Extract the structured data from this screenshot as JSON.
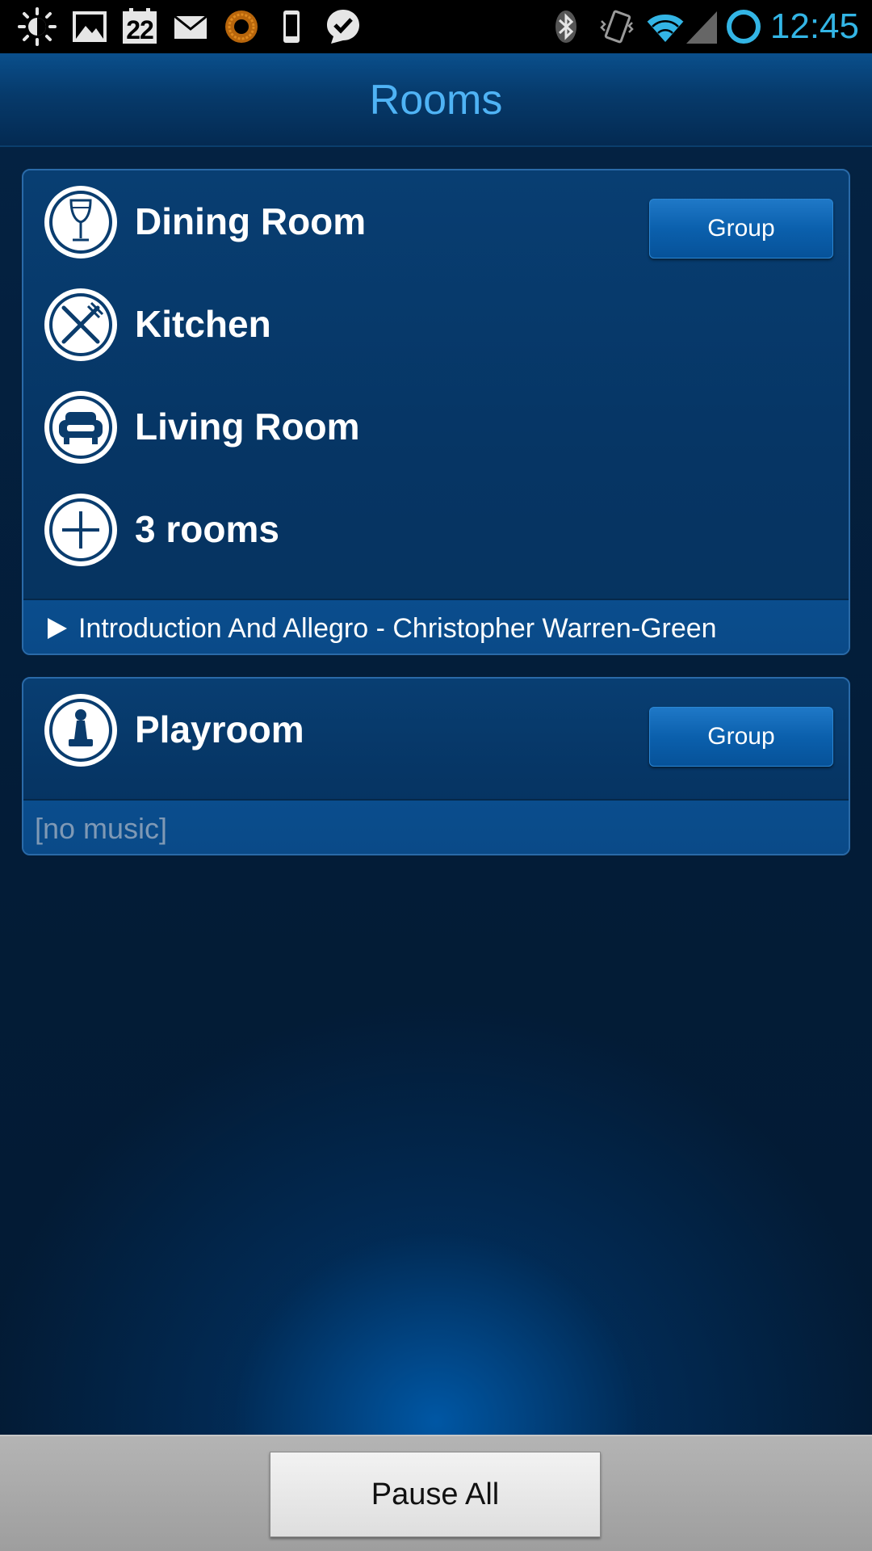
{
  "status_bar": {
    "time": "12:45",
    "calendar_day": "22",
    "accent_color": "#33b5e5",
    "left_icons": [
      "brightness-icon",
      "gallery-icon",
      "calendar-icon",
      "email-icon",
      "sun-widget-icon",
      "phone-icon",
      "check-bubble-icon"
    ],
    "right_icons": [
      "bluetooth-icon",
      "vibrate-icon",
      "wifi-icon",
      "signal-icon",
      "sync-ring-icon"
    ]
  },
  "header": {
    "title": "Rooms",
    "title_color": "#4fb3f5"
  },
  "groups": [
    {
      "rooms": [
        {
          "name": "Dining Room",
          "icon": "wine-glass-icon"
        },
        {
          "name": "Kitchen",
          "icon": "fork-knife-icon"
        },
        {
          "name": "Living Room",
          "icon": "sofa-icon"
        },
        {
          "name": "3 rooms",
          "icon": "plus-icon"
        }
      ],
      "group_button": "Group",
      "now_playing": "Introduction And Allegro - Christopher Warren-Green",
      "now_playing_icon": "play-icon"
    },
    {
      "rooms": [
        {
          "name": "Playroom",
          "icon": "chess-pawn-icon"
        }
      ],
      "group_button": "Group",
      "now_playing": "[no music]"
    }
  ],
  "bottom_bar": {
    "pause_all_label": "Pause All"
  }
}
